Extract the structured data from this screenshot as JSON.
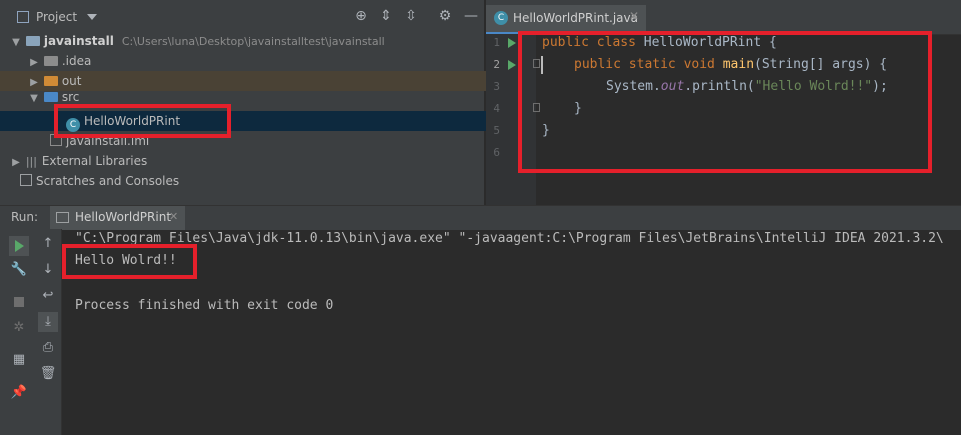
{
  "project": {
    "header_title": "Project",
    "tree": {
      "root_name": "javainstall",
      "root_path": "C:\\Users\\luna\\Desktop\\javainstalltest\\javainstall",
      "idea": ".idea",
      "out": "out",
      "src": "src",
      "class_file": "HelloWorldPRint",
      "iml": "javainstall.iml",
      "external": "External Libraries",
      "scratches": "Scratches and Consoles"
    }
  },
  "editor": {
    "tab_label": "HelloWorldPRint.java",
    "line_numbers": [
      "1",
      "2",
      "3",
      "4",
      "5",
      "6"
    ],
    "code": {
      "l1_kw": "public class ",
      "l1_name": "HelloWorldPRint {",
      "l2_kw": "public static void ",
      "l2_fn": "main",
      "l2_rest": "(String[] args) {",
      "l3_a": "System.",
      "l3_out": "out",
      "l3_b": ".println(",
      "l3_str": "\"Hello Wolrd!!\"",
      "l3_c": ");",
      "l4": "}",
      "l5": "}"
    }
  },
  "run": {
    "label": "Run:",
    "tab_label": "HelloWorldPRint",
    "console": {
      "command": "\"C:\\Program Files\\Java\\jdk-11.0.13\\bin\\java.exe\" \"-javaagent:C:\\Program Files\\JetBrains\\IntelliJ IDEA 2021.3.2\\",
      "output": "Hello Wolrd!!",
      "exit": "Process finished with exit code 0"
    }
  },
  "colors": {
    "highlight": "#e5202b",
    "accent": "#4a88c7",
    "run_green": "#59a869"
  }
}
